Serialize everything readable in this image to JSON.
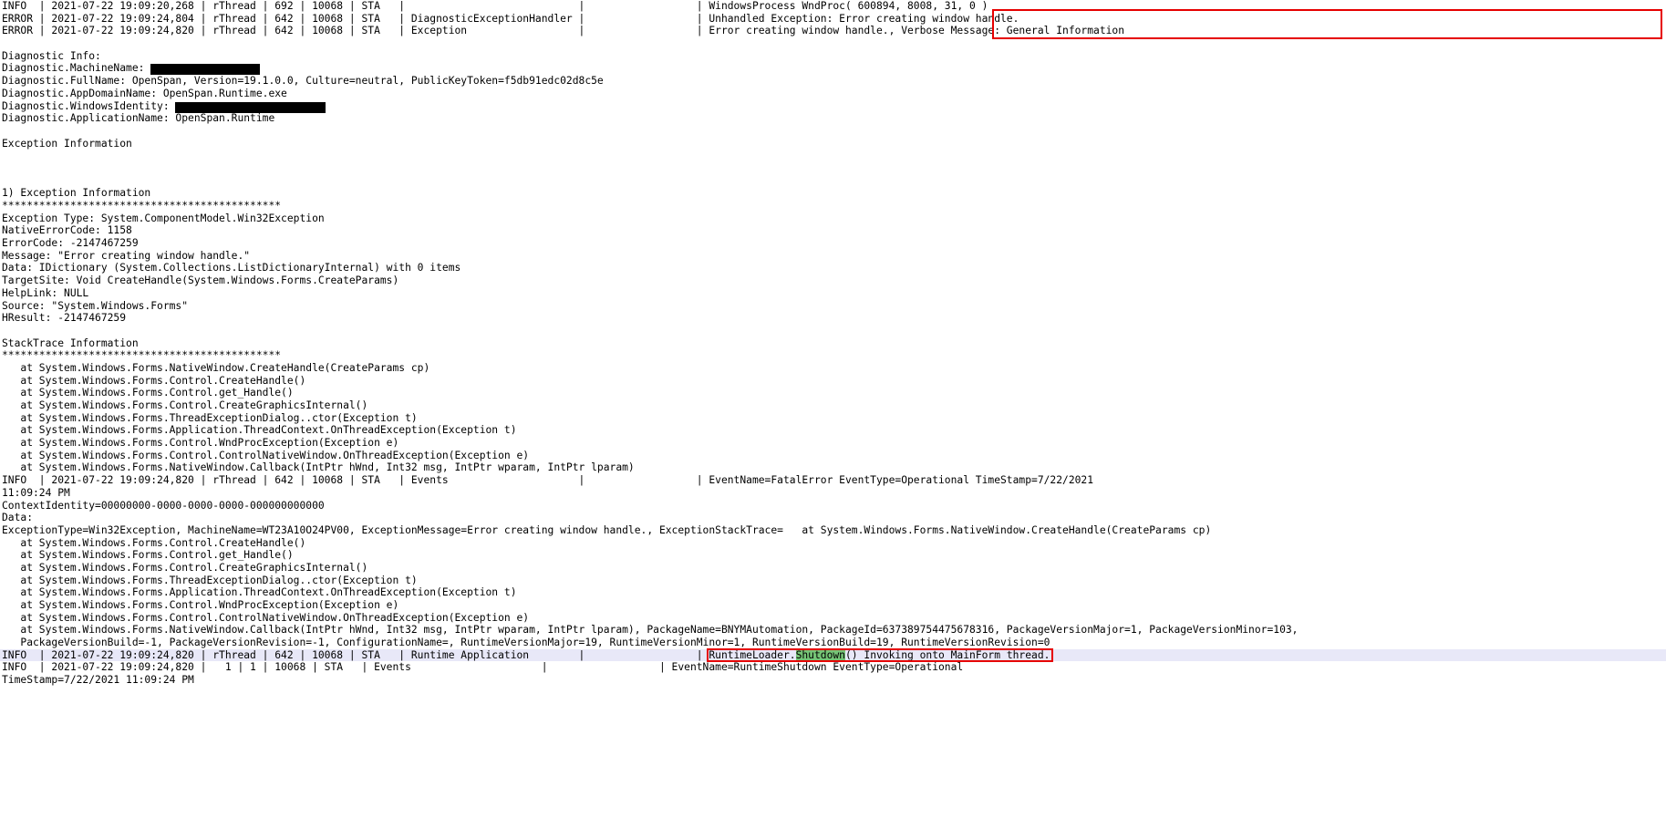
{
  "app": {
    "type": "log-viewer",
    "title": "OpenSpan Runtime diagnostic log",
    "accent_red": "#e60000",
    "highlight_green": "#76c476",
    "highlight_row": "#e8e8f8"
  },
  "log": {
    "lines": [
      "INFO  | 2021-07-22 19:09:20,268 | rThread | 692 | 10068 | STA   |                            |                  | WindowsProcess WndProc( 600894, 8008, 31, 0 )",
      "ERROR | 2021-07-22 19:09:24,804 | rThread | 642 | 10068 | STA   | DiagnosticExceptionHandler |                  | Unhandled Exception: Error creating window handle.",
      "ERROR | 2021-07-22 19:09:24,820 | rThread | 642 | 10068 | STA   | Exception                  |                  | Error creating window handle., Verbose Message: General Information",
      "",
      "Diagnostic Info:",
      "Diagnostic.MachineName: [[REDACT:120]]",
      "Diagnostic.FullName: OpenSpan, Version=19.1.0.0, Culture=neutral, PublicKeyToken=f5db91edc02d8c5e",
      "Diagnostic.AppDomainName: OpenSpan.Runtime.exe",
      "Diagnostic.WindowsIdentity: [[REDACT:165]]",
      "Diagnostic.ApplicationName: OpenSpan.Runtime",
      "",
      "Exception Information",
      "",
      "",
      "",
      "1) Exception Information",
      "*********************************************",
      "Exception Type: System.ComponentModel.Win32Exception",
      "NativeErrorCode: 1158",
      "ErrorCode: -2147467259",
      "Message: \"Error creating window handle.\"",
      "Data: IDictionary (System.Collections.ListDictionaryInternal) with 0 items",
      "TargetSite: Void CreateHandle(System.Windows.Forms.CreateParams)",
      "HelpLink: NULL",
      "Source: \"System.Windows.Forms\"",
      "HResult: -2147467259",
      "",
      "StackTrace Information",
      "*********************************************",
      "   at System.Windows.Forms.NativeWindow.CreateHandle(CreateParams cp)",
      "   at System.Windows.Forms.Control.CreateHandle()",
      "   at System.Windows.Forms.Control.get_Handle()",
      "   at System.Windows.Forms.Control.CreateGraphicsInternal()",
      "   at System.Windows.Forms.ThreadExceptionDialog..ctor(Exception t)",
      "   at System.Windows.Forms.Application.ThreadContext.OnThreadException(Exception t)",
      "   at System.Windows.Forms.Control.WndProcException(Exception e)",
      "   at System.Windows.Forms.Control.ControlNativeWindow.OnThreadException(Exception e)",
      "   at System.Windows.Forms.NativeWindow.Callback(IntPtr hWnd, Int32 msg, IntPtr wparam, IntPtr lparam)",
      "INFO  | 2021-07-22 19:09:24,820 | rThread | 642 | 10068 | STA   | Events                     |                  | EventName=FatalError EventType=Operational TimeStamp=7/22/2021",
      "11:09:24 PM",
      "ContextIdentity=00000000-0000-0000-0000-000000000000",
      "Data:",
      "ExceptionType=Win32Exception, MachineName=WT23A10O24PV00, ExceptionMessage=Error creating window handle., ExceptionStackTrace=   at System.Windows.Forms.NativeWindow.CreateHandle(CreateParams cp)",
      "   at System.Windows.Forms.Control.CreateHandle()",
      "   at System.Windows.Forms.Control.get_Handle()",
      "   at System.Windows.Forms.Control.CreateGraphicsInternal()",
      "   at System.Windows.Forms.ThreadExceptionDialog..ctor(Exception t)",
      "   at System.Windows.Forms.Application.ThreadContext.OnThreadException(Exception t)",
      "   at System.Windows.Forms.Control.WndProcException(Exception e)",
      "   at System.Windows.Forms.Control.ControlNativeWindow.OnThreadException(Exception e)",
      "   at System.Windows.Forms.NativeWindow.Callback(IntPtr hWnd, Int32 msg, IntPtr wparam, IntPtr lparam), PackageName=BNYMAutomation, PackageId=637389754475678316, PackageVersionMajor=1, PackageVersionMinor=103,",
      "   PackageVersionBuild=-1, PackageVersionRevision=-1, ConfigurationName=, RuntimeVersionMajor=19, RuntimeVersionMinor=1, RuntimeVersionBuild=19, RuntimeVersionRevision=0"
    ],
    "highlighted_row": {
      "prefix": "INFO  | 2021-07-22 19:09:24,820 | rThread | 642 | 10068 | STA   | Runtime Application        |                  | RuntimeLoader.",
      "green_token": "Shutdown",
      "suffix": "() Invoking onto MainForm thread."
    },
    "footer_lines": [
      "INFO  | 2021-07-22 19:09:24,820 |   1 | 1 | 10068 | STA   | Events                     |                  | EventName=RuntimeShutdown EventType=Operational",
      "TimeStamp=7/22/2021 11:09:24 PM"
    ]
  },
  "annotations": {
    "top_callout": {
      "line1": "| Unhandled Exception: Error creating window handle.",
      "line2": "Error creating window handle., Verbose Message: General Information"
    },
    "bottom_callout_label": "RuntimeLoader.Shutdown() Invoking onto MainForm thread."
  }
}
